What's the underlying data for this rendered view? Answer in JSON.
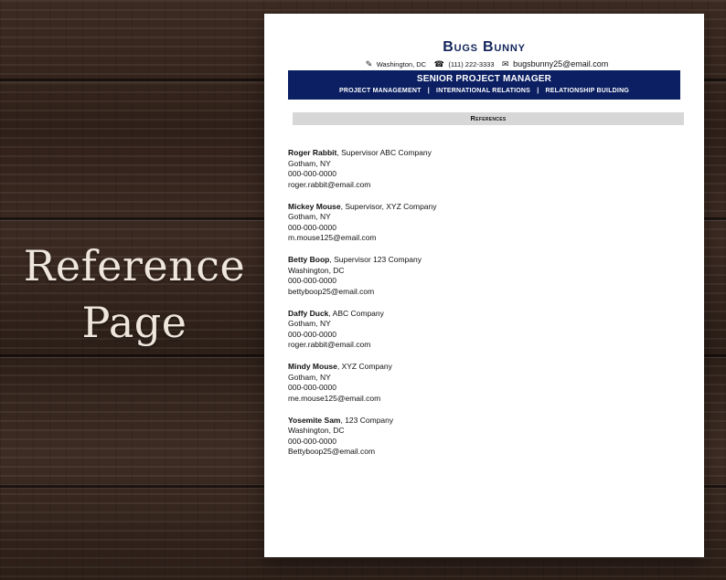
{
  "overlay": {
    "title_line1": "Reference",
    "title_line2": "Page"
  },
  "resume": {
    "name": "Bugs Bunny",
    "contact": {
      "location": "Washington, DC",
      "phone": "(111) 222-3333",
      "email": "bugsbunny25@email.com"
    },
    "job_title": "SENIOR PROJECT MANAGER",
    "skills": [
      "PROJECT MANAGEMENT",
      "INTERNATIONAL RELATIONS",
      "RELATIONSHIP BUILDING"
    ],
    "section_title": "References",
    "references": [
      {
        "name": "Roger Rabbit",
        "role_company": ", Supervisor ABC Company",
        "location": "Gotham, NY",
        "phone": "000-000-0000",
        "email": "roger.rabbit@email.com"
      },
      {
        "name": "Mickey Mouse",
        "role_company": ", Supervisor, XYZ Company",
        "location": "Gotham, NY",
        "phone": "000-000-0000",
        "email": "m.mouse125@email.com"
      },
      {
        "name": "Betty Boop",
        "role_company": ", Supervisor 123 Company",
        "location": "Washington, DC",
        "phone": "000-000-0000",
        "email": "bettyboop25@email.com"
      },
      {
        "name": "Daffy Duck",
        "role_company": ", ABC Company",
        "location": "Gotham, NY",
        "phone": "000-000-0000",
        "email": "roger.rabbit@email.com"
      },
      {
        "name": "Mindy Mouse",
        "role_company": ", XYZ Company",
        "location": "Gotham, NY",
        "phone": "000-000-0000",
        "email": "me.mouse125@email.com"
      },
      {
        "name": "Yosemite Sam",
        "role_company": ", 123 Company",
        "location": "Washington, DC",
        "phone": "000-000-0000",
        "email": "Bettyboop25@email.com"
      }
    ]
  },
  "colors": {
    "navy": "#0b1f62",
    "name_blue": "#12255a",
    "section_gray": "#d7d7d7",
    "overlay_text": "#efe6dc"
  },
  "icons": {
    "location": "map-icon",
    "phone": "phone-icon",
    "email": "envelope-icon"
  }
}
